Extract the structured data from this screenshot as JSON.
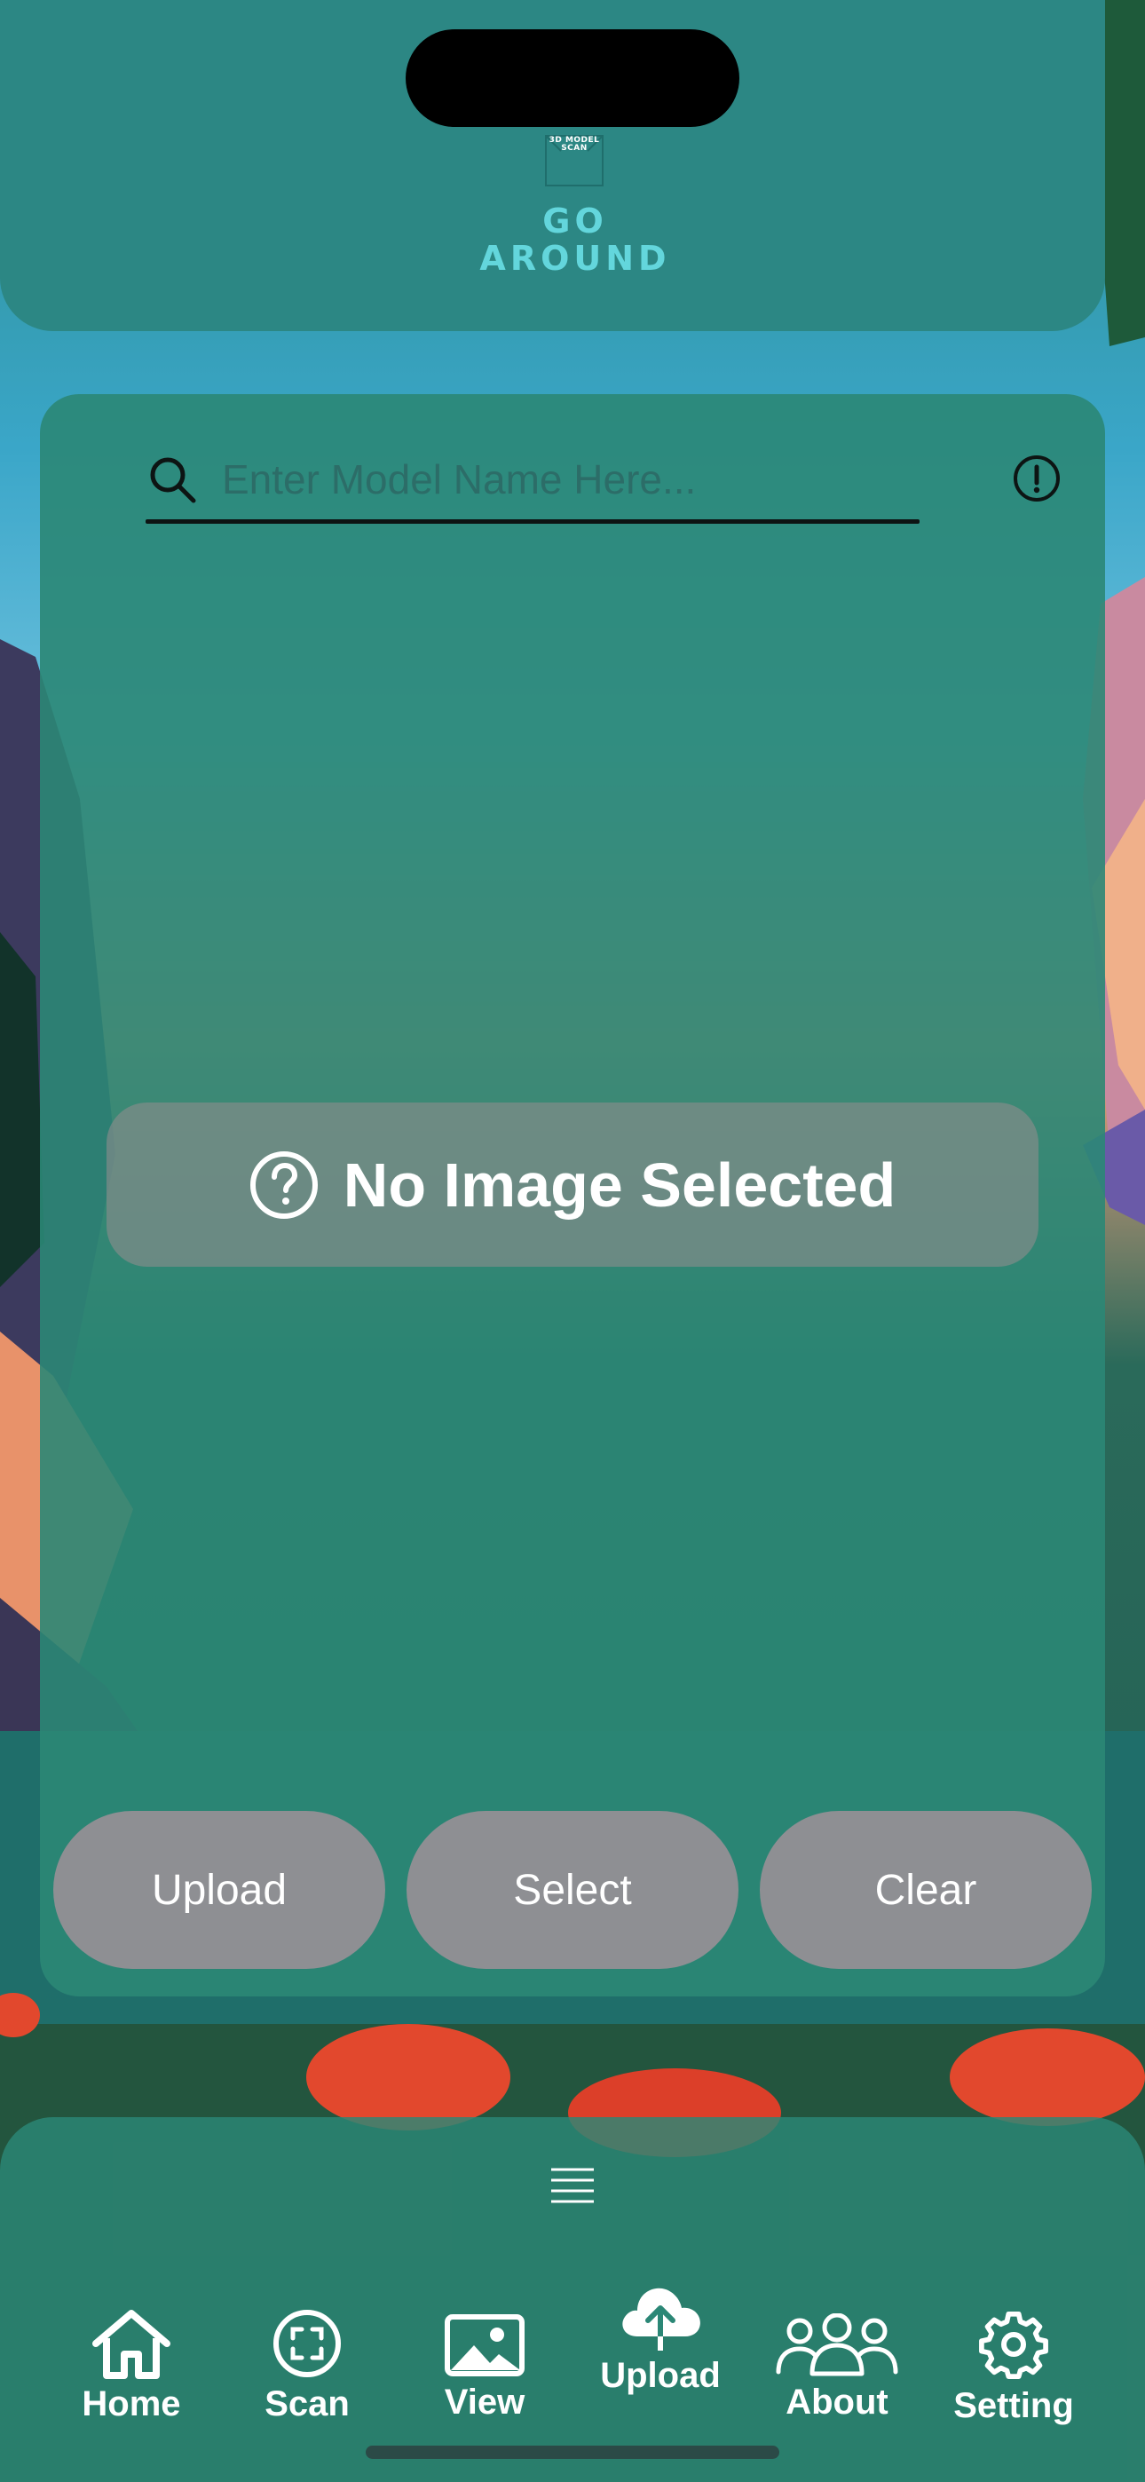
{
  "header": {
    "logo_small_text": "3D MODEL SCAN",
    "logo_line1": "GO",
    "logo_line2": "AROUND"
  },
  "search": {
    "placeholder": "Enter Model Name Here..."
  },
  "image_area": {
    "status_text": "No Image Selected"
  },
  "actions": {
    "upload_label": "Upload",
    "select_label": "Select",
    "clear_label": "Clear"
  },
  "tabs": [
    {
      "label": "Home",
      "icon": "home-icon"
    },
    {
      "label": "Scan",
      "icon": "scan-icon"
    },
    {
      "label": "View",
      "icon": "image-icon"
    },
    {
      "label": "Upload",
      "icon": "cloud-upload-icon"
    },
    {
      "label": "About",
      "icon": "people-icon"
    },
    {
      "label": "Setting",
      "icon": "gear-icon"
    }
  ],
  "colors": {
    "accent": "#63d6dc",
    "panel": "#2b8776",
    "button": "#8e8f93"
  }
}
